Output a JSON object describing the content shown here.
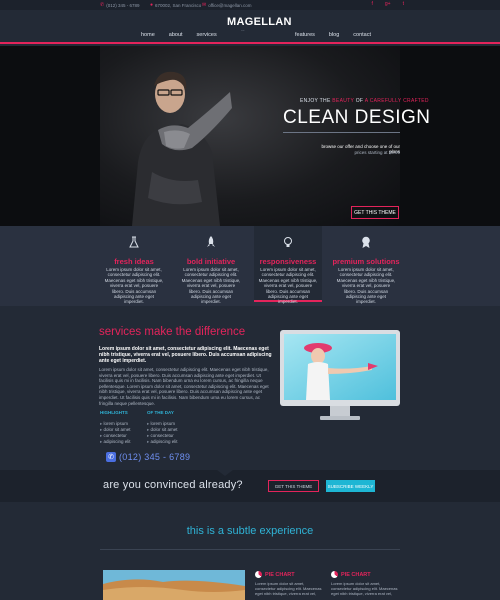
{
  "topbar": {
    "phone": "(012) 345 - 6789",
    "address": "670002, San Francisco",
    "email": "office@magellan.com",
    "social": [
      "f",
      "g+",
      "t"
    ]
  },
  "header": {
    "logo": "MAGELLAN",
    "logo_sub": "~~",
    "nav_left": [
      "home",
      "about",
      "services"
    ],
    "nav_right": [
      "features",
      "blog",
      "contact"
    ]
  },
  "hero": {
    "tag_pre": "ENJOY THE",
    "tag_accent": "BEAUTY",
    "tag_mid": "OF",
    "tag_accent2": "A CAREFULLY CRAFTED",
    "title": "CLEAN DESIGN",
    "desc": "browse our offer and choose one of our plans",
    "price": "prices starting at $5.99",
    "button": "GET THIS THEME"
  },
  "features": [
    {
      "icon": "flask-icon",
      "title": "fresh ideas",
      "text": "Lorem ipsum dolor sit amet, consectetur adipiscing elit. Maecenas eget nibh tristique, viverra erat vel, posuere libero. Duis accumsan adipiscing ante eget imperdiet."
    },
    {
      "icon": "rocket-icon",
      "title": "bold initiative",
      "text": "Lorem ipsum dolor sit amet, consectetur adipiscing elit. Maecenas eget nibh tristique, viverra erat vel, posuere libero. Duis accumsan adipiscing ante eget imperdiet."
    },
    {
      "icon": "lightbulb-icon",
      "title": "responsiveness",
      "text": "Lorem ipsum dolor sit amet, consectetur adipiscing elit. Maecenas eget nibh tristique, viverra erat vel, posuere libero. Duis accumsan adipiscing ante eget imperdiet."
    },
    {
      "icon": "award-icon",
      "title": "premium solutions",
      "text": "Lorem ipsum dolor sit amet, consectetur adipiscing elit. Maecenas eget nibh tristique, viverra erat vel, posuere libero. Duis accumsan adipiscing ante eget imperdiet."
    }
  ],
  "services": {
    "title": "services make the difference",
    "lead": "Lorem ipsum dolor sit amet, consectetur adipiscing elit. Maecenas eget nibh tristique, viverra erat vel, posuere libero. Duis accumsan adipiscing ante eget imperdiet.",
    "body": "Lorem ipsum dolor sit amet, consectetur adipiscing elit. Maecenas eget nibh tristique, viverra erat vel, posuere libero. Duis accumsan adipiscing ante eget imperdiet. Ut facilisis quis mi in facilisis. Nam bibendum urna eu lorem cursus, ac fringilla neque pellentesque. Lorem ipsum dolor sit amet, consectetur adipiscing elit. Maecenas eget nibh tristique, viverra erat vel, posuere libero. Duis accumsan adipiscing ante eget imperdiet. Ut facilisis quis mi in facilisis. Nam bibendum urna eu lorem cursus, ac fringilla neque pellentesque.",
    "list1_head": "HIGHLIGHTS",
    "list1": [
      "lorem ipsum",
      "dolor sit amet",
      "consectetur",
      "adipiscing elit"
    ],
    "list2_head": "OF THE DAY",
    "list2": [
      "lorem ipsum",
      "dolor sit amet",
      "consectetur",
      "adipiscing elit"
    ],
    "phone": "(012) 345 - 6789"
  },
  "cta": {
    "text": "are you convinced already?",
    "button1": "GET THIS THEME",
    "button2": "SUBSCRIBE WEEKLY"
  },
  "subtle": {
    "title": "this is a subtle experience",
    "pies": [
      {
        "title": "PIE CHART",
        "text": "Lorem ipsum dolor sit amet, consectetur adipiscing elit. Maecenas eget nibh tristique, viverra erat vel,"
      },
      {
        "title": "PIE CHART",
        "text": "Lorem ipsum dolor sit amet, consectetur adipiscing elit. Maecenas eget nibh tristique, viverra erat vel,"
      }
    ]
  },
  "colors": {
    "accent": "#e3245b",
    "cyan": "#1eb6d4",
    "bg": "#232a36"
  }
}
